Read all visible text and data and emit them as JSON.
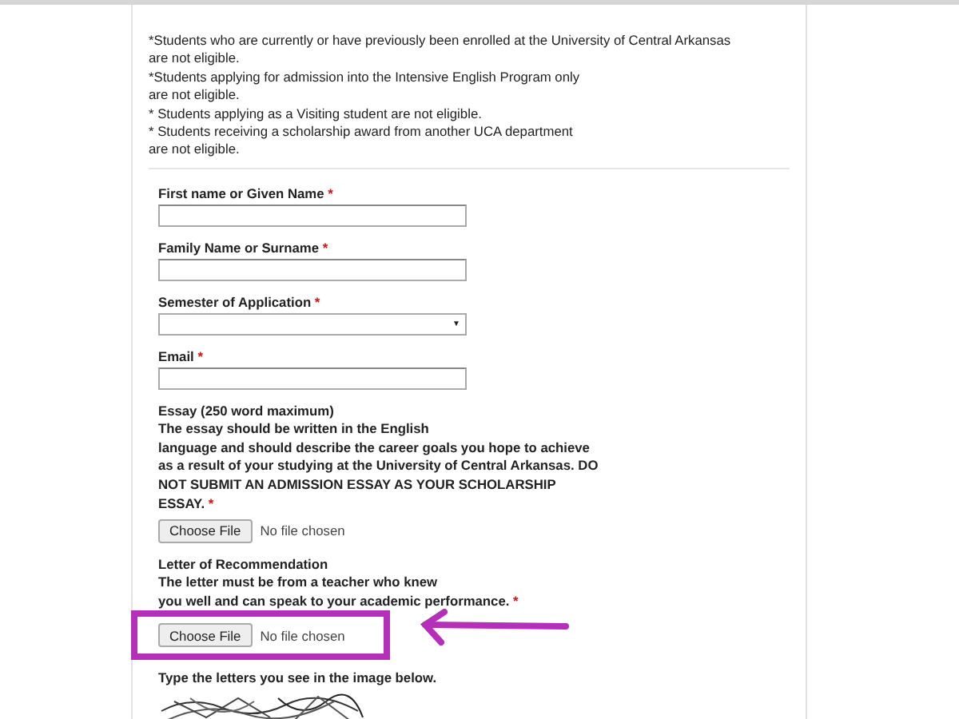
{
  "notes": [
    "*Students who are currently or have previously been enrolled at the University of Central Arkansas",
    "are not eligible.",
    "*Students applying for admission into the Intensive English Program only",
    "are not eligible.",
    "* Students applying as a Visiting student are not eligible.",
    "* Students receiving a scholarship award from another UCA department",
    "are not eligible."
  ],
  "fields": [
    {
      "kind": "text",
      "label": "First name or Given Name",
      "required": true
    },
    {
      "kind": "text",
      "label": "Family Name or Surname",
      "required": true
    },
    {
      "kind": "select",
      "label": "Semester of Application",
      "required": true,
      "caret": "▼"
    },
    {
      "kind": "text",
      "label": "Email",
      "required": true
    },
    {
      "kind": "file",
      "label": "Essay (250 word maximum)",
      "description": [
        "The essay should be written in the English",
        "language and should describe the career goals you hope to achieve",
        "as a result of your studying at the University of Central Arkansas. DO",
        "NOT SUBMIT AN ADMISSION ESSAY AS YOUR SCHOLARSHIP",
        "ESSAY."
      ],
      "required": true,
      "button": "Choose File",
      "status": "No file chosen",
      "highlighted": false
    },
    {
      "kind": "file",
      "label": "Letter of Recommendation",
      "description": [
        "The letter must be from a teacher who knew",
        "you well and can speak to your academic performance."
      ],
      "required": true,
      "button": "Choose File",
      "status": "No file chosen",
      "highlighted": true
    }
  ],
  "required_mark": "*",
  "captcha": {
    "label": "Type the letters you see in the image below.",
    "kind": "picture"
  }
}
